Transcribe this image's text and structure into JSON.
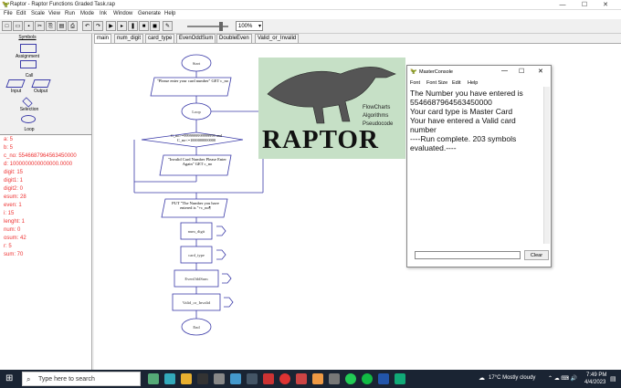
{
  "window": {
    "title": "Raptor - Raptor Functions Graded Task.rap",
    "min": "—",
    "max": "☐",
    "close": "✕"
  },
  "menu": [
    "File",
    "Edit",
    "Scale",
    "View",
    "Run",
    "Mode",
    "Ink",
    "Window",
    "Generate",
    "Help"
  ],
  "toolbar": {
    "zoom": "100%"
  },
  "symbols": {
    "title": "Symbols",
    "assignment": "Assignment",
    "call": "Call",
    "input": "Input",
    "output": "Output",
    "selection": "Selection",
    "loop": "Loop"
  },
  "vars": [
    "a: 5",
    "b: 5",
    "c_no: 5546687964563450000",
    "d: 1000000000000000.0000",
    "digit: 15",
    "digit1: 1",
    "digit2: 0",
    "esum: 28",
    "even: 1",
    "i: 15",
    "lenght: 1",
    "num: 0",
    "osum: 42",
    "r: 5",
    "sum: 70"
  ],
  "tabs": [
    "main",
    "num_digit",
    "card_type",
    "EvenOddSum",
    "DoubleEven",
    "Valid_or_Invalid"
  ],
  "flow": {
    "start": "Start",
    "in1": "\"Please enter your card number\" GET c_no",
    "loop": "Loop",
    "cond": "C_no>=9999999999999999 and C_no<=1000000000000",
    "in2": "\"Invalid Card Number Please Enter Again\" GET c_no",
    "put": "PUT \"The Number you have entered is \"+c_no¶",
    "call1": "num_digit",
    "call2": "card_type",
    "call3": "EvenOddSum",
    "call4": "Valid_or_Invalid",
    "end": "End",
    "yes": "Yes",
    "no": "No"
  },
  "splash": {
    "logo": "RAPTOR",
    "l1": "FlowCharts",
    "l2": "Algorithms",
    "l3": "Pseudocode"
  },
  "console": {
    "title": "MasterConsole",
    "menu": [
      "Font",
      "Font Size",
      "Edit",
      "Help"
    ],
    "lines": [
      "The Number you have entered is 5546687964563450000",
      "Your card type is Master Card",
      "Your have entered a Valid card number",
      "----Run complete.  203 symbols evaluated.----"
    ],
    "clear": "Clear"
  },
  "taskbar": {
    "search": "Type here to search",
    "weather": "17°C  Mostly cloudy",
    "time": "7:49 PM",
    "date": "4/4/2023"
  },
  "colors": {
    "accent": "#3a3aa8",
    "vars": "#ee3333",
    "splash": "#c6e0c6",
    "taskbar": "#1a2433"
  }
}
